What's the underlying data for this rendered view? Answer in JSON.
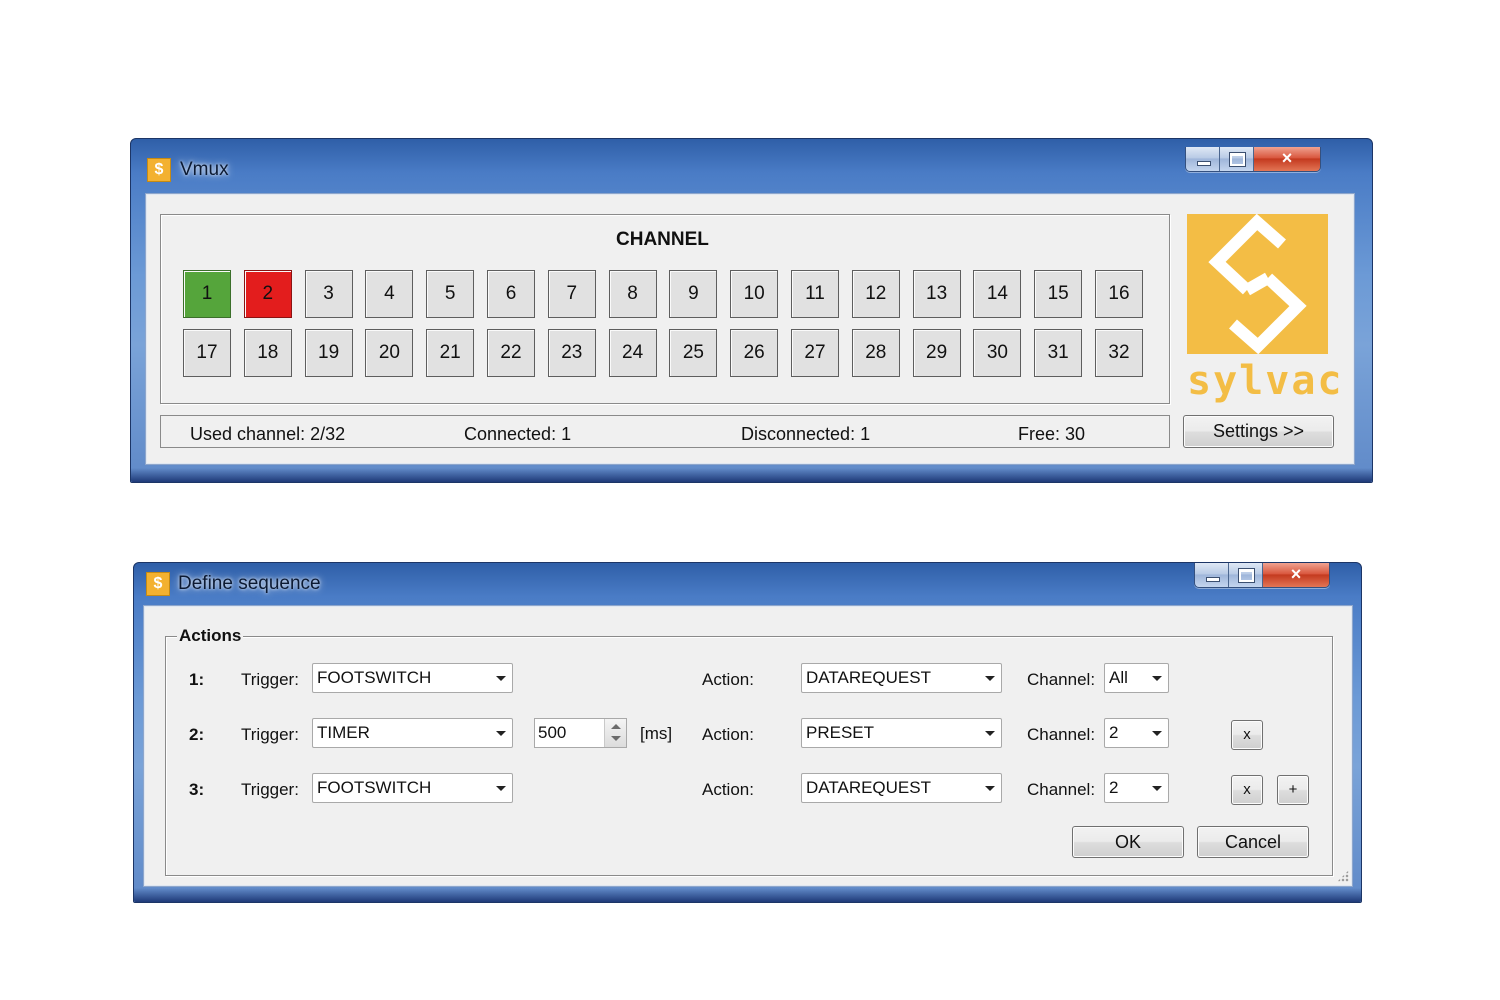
{
  "vmux": {
    "title": "Vmux",
    "app_icon": "sylvac-s-icon",
    "group_title": "CHANNEL",
    "channels": [
      {
        "label": "1",
        "state": "connected",
        "color": "#55a53b"
      },
      {
        "label": "2",
        "state": "disconnected",
        "color": "#e31d1d"
      },
      {
        "label": "3",
        "state": "free"
      },
      {
        "label": "4",
        "state": "free"
      },
      {
        "label": "5",
        "state": "free"
      },
      {
        "label": "6",
        "state": "free"
      },
      {
        "label": "7",
        "state": "free"
      },
      {
        "label": "8",
        "state": "free"
      },
      {
        "label": "9",
        "state": "free"
      },
      {
        "label": "10",
        "state": "free"
      },
      {
        "label": "11",
        "state": "free"
      },
      {
        "label": "12",
        "state": "free"
      },
      {
        "label": "13",
        "state": "free"
      },
      {
        "label": "14",
        "state": "free"
      },
      {
        "label": "15",
        "state": "free"
      },
      {
        "label": "16",
        "state": "free"
      },
      {
        "label": "17",
        "state": "free"
      },
      {
        "label": "18",
        "state": "free"
      },
      {
        "label": "19",
        "state": "free"
      },
      {
        "label": "20",
        "state": "free"
      },
      {
        "label": "21",
        "state": "free"
      },
      {
        "label": "22",
        "state": "free"
      },
      {
        "label": "23",
        "state": "free"
      },
      {
        "label": "24",
        "state": "free"
      },
      {
        "label": "25",
        "state": "free"
      },
      {
        "label": "26",
        "state": "free"
      },
      {
        "label": "27",
        "state": "free"
      },
      {
        "label": "28",
        "state": "free"
      },
      {
        "label": "29",
        "state": "free"
      },
      {
        "label": "30",
        "state": "free"
      },
      {
        "label": "31",
        "state": "free"
      },
      {
        "label": "32",
        "state": "free"
      }
    ],
    "status": {
      "used": "Used channel: 2/32",
      "connected": "Connected: 1",
      "disconnected": "Disconnected: 1",
      "free": "Free: 30"
    },
    "settings_label": "Settings >>",
    "logo_text": "sylvac",
    "logo_color": "#f3bd45"
  },
  "sequence": {
    "title": "Define sequence",
    "group_title": "Actions",
    "rows": [
      {
        "num": "1:",
        "trigger_label": "Trigger:",
        "trigger": "FOOTSWITCH",
        "action_label": "Action:",
        "action": "DATAREQUEST",
        "channel_label": "Channel:",
        "channel": "All"
      },
      {
        "num": "2:",
        "trigger_label": "Trigger:",
        "trigger": "TIMER",
        "timer_value": "500",
        "timer_unit": "[ms]",
        "action_label": "Action:",
        "action": "PRESET",
        "channel_label": "Channel:",
        "channel": "2",
        "remove": "x"
      },
      {
        "num": "3:",
        "trigger_label": "Trigger:",
        "trigger": "FOOTSWITCH",
        "action_label": "Action:",
        "action": "DATAREQUEST",
        "channel_label": "Channel:",
        "channel": "2",
        "remove": "x",
        "add": "+"
      }
    ],
    "ok_label": "OK",
    "cancel_label": "Cancel"
  },
  "window_controls": {
    "minimize": "minimize-icon",
    "maximize": "maximize-icon",
    "close": "×"
  },
  "colors": {
    "titlebar": "#4a7cc6",
    "client": "#f0f0f0",
    "close": "#c43a1f"
  }
}
